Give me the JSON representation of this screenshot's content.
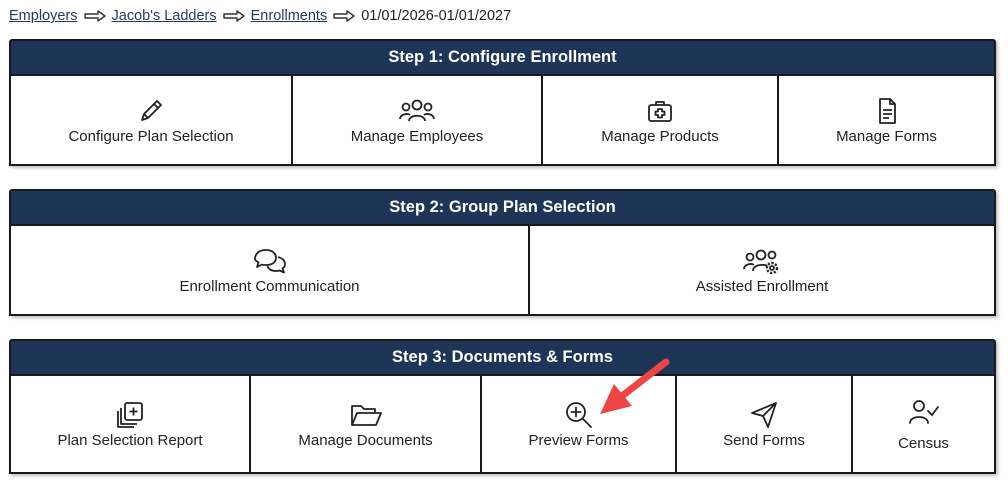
{
  "breadcrumb": {
    "items": [
      "Employers",
      "Jacob's Ladders",
      "Enrollments"
    ],
    "current": "01/01/2026-01/01/2027"
  },
  "step1": {
    "title": "Step 1: Configure Enrollment",
    "items": [
      {
        "label": "Configure Plan Selection",
        "icon": "pencil-icon"
      },
      {
        "label": "Manage Employees",
        "icon": "users-icon"
      },
      {
        "label": "Manage Products",
        "icon": "medical-bag-icon"
      },
      {
        "label": "Manage Forms",
        "icon": "document-icon"
      }
    ]
  },
  "step2": {
    "title": "Step 2: Group Plan Selection",
    "items": [
      {
        "label": "Enrollment Communication",
        "icon": "chat-bubbles-icon"
      },
      {
        "label": "Assisted Enrollment",
        "icon": "users-gear-icon"
      }
    ]
  },
  "step3": {
    "title": "Step 3: Documents & Forms",
    "items": [
      {
        "label": "Plan Selection Report",
        "icon": "copy-plus-icon"
      },
      {
        "label": "Manage Documents",
        "icon": "folder-open-icon"
      },
      {
        "label": "Preview Forms",
        "icon": "zoom-in-icon"
      },
      {
        "label": "Send Forms",
        "icon": "paper-plane-icon"
      },
      {
        "label": "Census",
        "icon": "user-check-icon"
      }
    ]
  },
  "colors": {
    "header_bg": "#1e3557",
    "annotation_arrow": "#ee4444"
  }
}
